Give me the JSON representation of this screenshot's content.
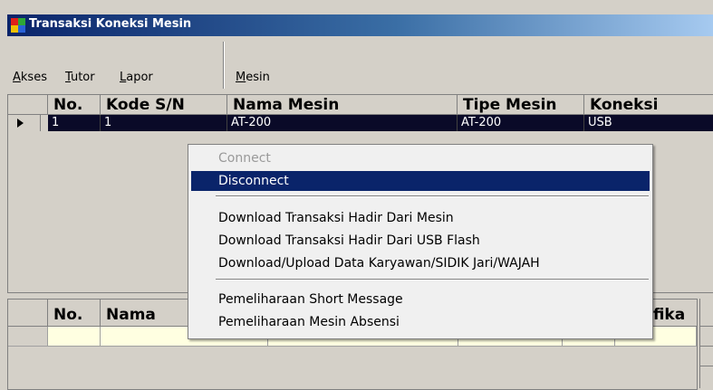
{
  "window": {
    "title": "Transaksi Koneksi Mesin"
  },
  "menubar": {
    "items": [
      {
        "key": "A",
        "rest": "kses"
      },
      {
        "key": "T",
        "rest": "utor"
      },
      {
        "key": "L",
        "rest": "apor"
      },
      {
        "key": "M",
        "rest": "esin"
      }
    ]
  },
  "machine_grid": {
    "headers": [
      "No.",
      "Kode S/N",
      "Nama Mesin",
      "Tipe Mesin",
      "Koneksi"
    ],
    "rows": [
      {
        "no": "1",
        "kode_sn": "1",
        "nama_mesin": "AT-200",
        "tipe_mesin": "AT-200",
        "koneksi": "USB"
      }
    ]
  },
  "lower_grid": {
    "headers": [
      "No.",
      "Nama",
      "ifika"
    ]
  },
  "context_menu": {
    "items": [
      {
        "label": "Connect",
        "state": "disabled"
      },
      {
        "label": "Disconnect",
        "state": "highlighted"
      },
      {
        "label": "Download Transaksi Hadir Dari Mesin",
        "state": "normal"
      },
      {
        "label": "Download Transaksi Hadir Dari USB Flash",
        "state": "normal"
      },
      {
        "label": "Download/Upload Data Karyawan/SIDIK Jari/WAJAH",
        "state": "normal"
      },
      {
        "label": "Pemeliharaan Short Message",
        "state": "normal"
      },
      {
        "label": "Pemeliharaan Mesin Absensi",
        "state": "normal"
      }
    ]
  },
  "colors": {
    "titlebar_start": "#0a246a",
    "selected_row": "#0a0a28",
    "menu_highlight": "#0a246a",
    "new_row": "#ffffe1"
  }
}
